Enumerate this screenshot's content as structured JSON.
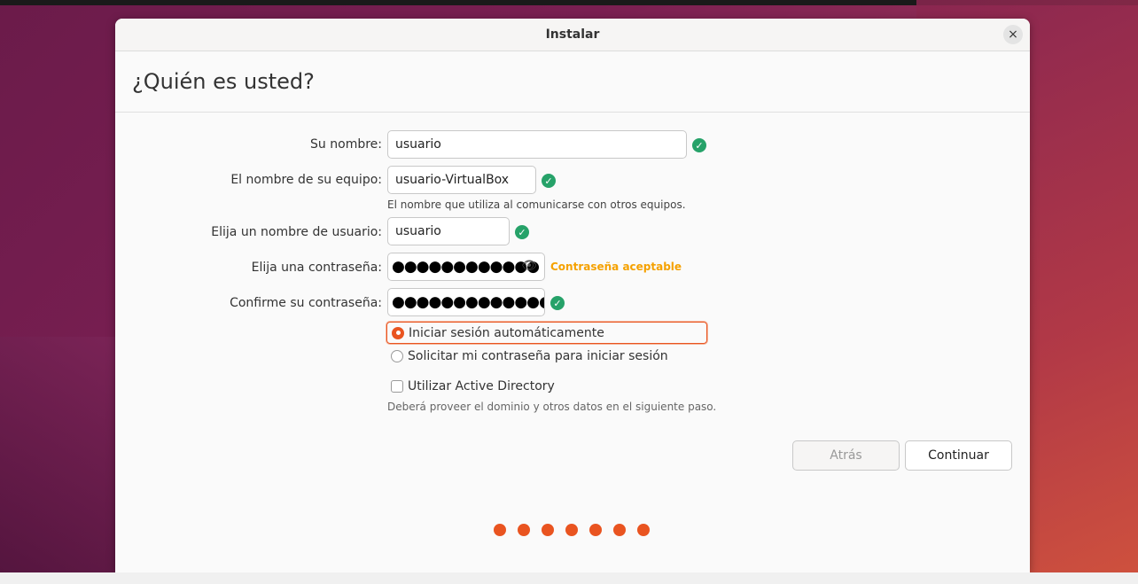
{
  "window": {
    "title": "Instalar",
    "close_symbol": "×",
    "heading": "¿Quién es usted?"
  },
  "form": {
    "name_label": "Su nombre:",
    "name_value": "usuario",
    "computer_label": "El nombre de su equipo:",
    "computer_value": "usuario-VirtualBox",
    "computer_hint": "El nombre que utiliza al comunicarse con otros equipos.",
    "username_label": "Elija un nombre de usuario:",
    "username_value": "usuario",
    "password_label": "Elija una contraseña:",
    "password_mask": "●●●●●●●●●●●●",
    "password_strength": "Contraseña aceptable",
    "confirm_label": "Confirme su contraseña:",
    "confirm_mask": "●●●●●●●●●●●●●",
    "check_symbol": "✓",
    "eye_symbol": "👁"
  },
  "login_options": {
    "auto_login_label": "Iniciar sesión automáticamente",
    "require_password_label": "Solicitar mi contraseña para iniciar sesión",
    "selected": "auto_login"
  },
  "active_directory": {
    "label": "Utilizar Active Directory",
    "checked": false,
    "hint": "Deberá proveer el dominio y otros datos en el siguiente paso."
  },
  "buttons": {
    "back_label": "Atrás",
    "continue_label": "Continuar"
  },
  "progress": {
    "steps": 7,
    "color": "#e95420"
  },
  "colors": {
    "accent": "#e95420",
    "success": "#26a269",
    "warning": "#f5a100"
  }
}
